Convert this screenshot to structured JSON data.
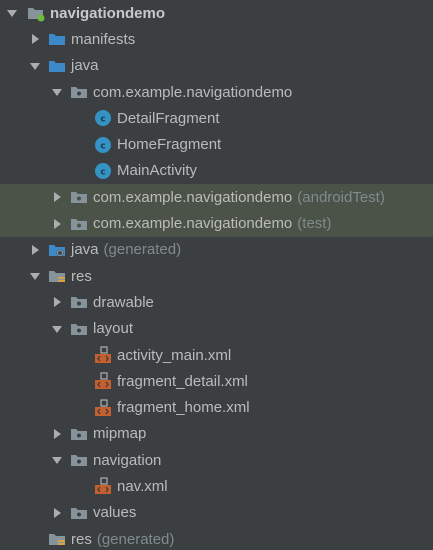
{
  "tree": {
    "root": {
      "label": "navigationdemo"
    },
    "manifests": {
      "label": "manifests"
    },
    "java": {
      "label": "java"
    },
    "pkg_main": {
      "label": "com.example.navigationdemo"
    },
    "detail_fragment": {
      "label": "DetailFragment"
    },
    "home_fragment": {
      "label": "HomeFragment"
    },
    "main_activity": {
      "label": "MainActivity"
    },
    "pkg_android_test": {
      "label": "com.example.navigationdemo",
      "suffix": "(androidTest)"
    },
    "pkg_test": {
      "label": "com.example.navigationdemo",
      "suffix": "(test)"
    },
    "java_generated": {
      "label": "java",
      "suffix": "(generated)"
    },
    "res": {
      "label": "res"
    },
    "drawable": {
      "label": "drawable"
    },
    "layout": {
      "label": "layout"
    },
    "activity_main": {
      "label": "activity_main.xml"
    },
    "fragment_detail": {
      "label": "fragment_detail.xml"
    },
    "fragment_home": {
      "label": "fragment_home.xml"
    },
    "mipmap": {
      "label": "mipmap"
    },
    "navigation": {
      "label": "navigation"
    },
    "nav_xml": {
      "label": "nav.xml"
    },
    "values": {
      "label": "values"
    },
    "res_generated": {
      "label": "res",
      "suffix": "(generated)"
    }
  },
  "colors": {
    "background": "#3c3f41",
    "highlight": "#4b5248",
    "text": "#bbbbbb",
    "muted": "#7f8c8d",
    "folder": "#87939a",
    "source_folder": "#3d88c9",
    "class_icon": "#3592c4",
    "xml_icon": "#c65f2e",
    "android_green": "#6fbc3c"
  }
}
